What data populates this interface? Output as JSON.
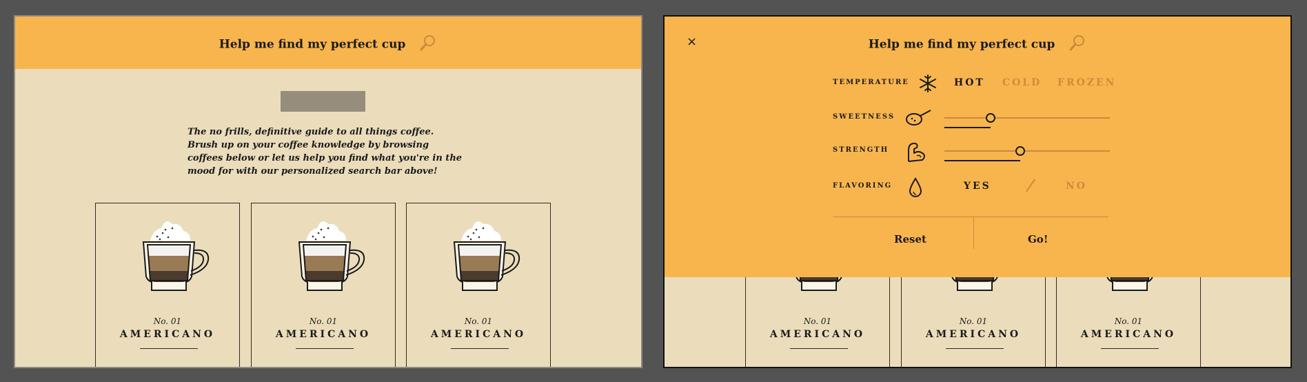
{
  "left_screen": {
    "header_title": "Help me find my perfect cup",
    "intro_text": "The no frills, definitive guide to all things coffee. Brush up on your coffee knowledge by browsing coffees below or let us help you find what you're in the mood for with our personalized search bar above!"
  },
  "cards": [
    {
      "number": "No. 01",
      "name": "AMERICANO"
    },
    {
      "number": "No. 01",
      "name": "AMERICANO"
    },
    {
      "number": "No. 01",
      "name": "AMERICANO"
    }
  ],
  "right_screen": {
    "header_title": "Help me find my perfect cup",
    "close_label": "×",
    "filters": {
      "temperature": {
        "label": "TEMPERATURE",
        "icon": "snowflake-icon",
        "options": [
          "HOT",
          "COLD",
          "FROZEN"
        ],
        "selected": "HOT"
      },
      "sweetness": {
        "label": "SWEETNESS",
        "icon": "spoon-icon",
        "level": 0.28
      },
      "strength": {
        "label": "STRENGTH",
        "icon": "flexed-arm-icon",
        "level": 0.46
      },
      "flavoring": {
        "label": "FLAVORING",
        "icon": "drop-icon",
        "options": [
          "YES",
          "NO"
        ],
        "selected": "YES"
      }
    },
    "reset_label": "Reset",
    "go_label": "Go!"
  },
  "colors": {
    "header_orange": "#f8b54e",
    "cream_bg": "#ebddbb",
    "inactive_option": "#cc8c3a",
    "ink": "#1a1a1a"
  }
}
